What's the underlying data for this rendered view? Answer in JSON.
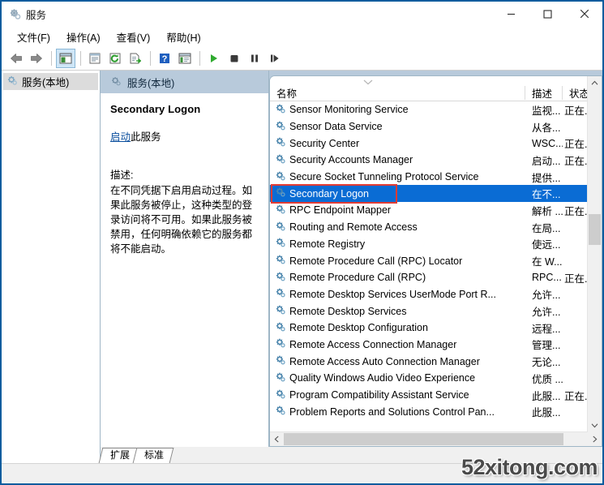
{
  "window": {
    "title": "服务",
    "icon": "services-gear-icon",
    "controls": {
      "minimize": "minimize-icon",
      "maximize": "maximize-icon",
      "close": "close-icon"
    }
  },
  "menubar": {
    "items": [
      {
        "label": "文件(F)",
        "name": "menu-file"
      },
      {
        "label": "操作(A)",
        "name": "menu-action"
      },
      {
        "label": "查看(V)",
        "name": "menu-view"
      },
      {
        "label": "帮助(H)",
        "name": "menu-help"
      }
    ]
  },
  "toolbar": {
    "buttons": [
      {
        "name": "back-button",
        "icon": "arrow-left-icon"
      },
      {
        "name": "forward-button",
        "icon": "arrow-right-icon"
      },
      {
        "name": "show-hide-tree-button",
        "icon": "tree-pane-icon",
        "active": true
      },
      {
        "name": "properties-button",
        "icon": "properties-icon"
      },
      {
        "name": "refresh-button",
        "icon": "refresh-icon"
      },
      {
        "name": "export-list-button",
        "icon": "export-icon"
      },
      {
        "name": "help-button",
        "icon": "help-question-icon"
      },
      {
        "name": "new-window-button",
        "icon": "new-window-icon"
      },
      {
        "name": "start-service-button",
        "icon": "play-icon"
      },
      {
        "name": "stop-service-button",
        "icon": "stop-icon"
      },
      {
        "name": "pause-service-button",
        "icon": "pause-icon"
      },
      {
        "name": "restart-service-button",
        "icon": "restart-icon"
      }
    ]
  },
  "tree": {
    "items": [
      {
        "label": "服务(本地)",
        "name": "tree-item-services-local",
        "selected": true
      }
    ]
  },
  "detail": {
    "header": "服务(本地)",
    "service_name": "Secondary Logon",
    "action_link": "启动",
    "action_suffix": "此服务",
    "description_label": "描述:",
    "description": "在不同凭据下启用启动过程。如果此服务被停止，这种类型的登录访问将不可用。如果此服务被禁用，任何明确依赖它的服务都将不能启动。"
  },
  "list": {
    "columns": [
      {
        "label": "名称",
        "name": "column-header-name"
      },
      {
        "label": "描述",
        "name": "column-header-description"
      },
      {
        "label": "状态",
        "name": "column-header-status"
      }
    ],
    "sort_indicator": "sort-descending-chevron-icon",
    "rows": [
      {
        "name": "Sensor Monitoring Service",
        "desc": "监视...",
        "status": "正在..."
      },
      {
        "name": "Sensor Data Service",
        "desc": "从各...",
        "status": ""
      },
      {
        "name": "Security Center",
        "desc": "WSC...",
        "status": "正在..."
      },
      {
        "name": "Security Accounts Manager",
        "desc": "启动...",
        "status": "正在..."
      },
      {
        "name": "Secure Socket Tunneling Protocol Service",
        "desc": "提供...",
        "status": ""
      },
      {
        "name": "Secondary Logon",
        "desc": "在不...",
        "status": "",
        "selected": true,
        "annotated": true
      },
      {
        "name": "RPC Endpoint Mapper",
        "desc": "解析 ...",
        "status": "正在..."
      },
      {
        "name": "Routing and Remote Access",
        "desc": "在局...",
        "status": ""
      },
      {
        "name": "Remote Registry",
        "desc": "使远...",
        "status": ""
      },
      {
        "name": "Remote Procedure Call (RPC) Locator",
        "desc": "在 W...",
        "status": ""
      },
      {
        "name": "Remote Procedure Call (RPC)",
        "desc": "RPC...",
        "status": "正在..."
      },
      {
        "name": "Remote Desktop Services UserMode Port R...",
        "desc": "允许...",
        "status": ""
      },
      {
        "name": "Remote Desktop Services",
        "desc": "允许...",
        "status": ""
      },
      {
        "name": "Remote Desktop Configuration",
        "desc": "远程...",
        "status": ""
      },
      {
        "name": "Remote Access Connection Manager",
        "desc": "管理...",
        "status": ""
      },
      {
        "name": "Remote Access Auto Connection Manager",
        "desc": "无论...",
        "status": ""
      },
      {
        "name": "Quality Windows Audio Video Experience",
        "desc": "优质 ...",
        "status": ""
      },
      {
        "name": "Program Compatibility Assistant Service",
        "desc": "此服...",
        "status": "正在..."
      },
      {
        "name": "Problem Reports and Solutions Control Pan...",
        "desc": "此服...",
        "status": ""
      }
    ]
  },
  "tabs": [
    {
      "label": "扩展",
      "name": "tab-extended"
    },
    {
      "label": "标准",
      "name": "tab-standard"
    }
  ],
  "watermark": "52xitong.com",
  "colors": {
    "accent": "#0b5c9e",
    "selection": "#0a6cd4",
    "annotation": "#e23b34",
    "panel_header": "#b8cadb"
  }
}
